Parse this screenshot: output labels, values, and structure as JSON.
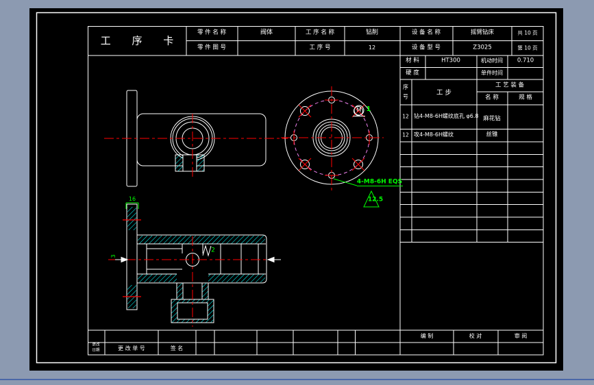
{
  "title_block": {
    "card_title": "工 序 卡",
    "part_name_label": "零 件 名 称",
    "part_name": "阀体",
    "part_no_label": "零 件 图 号",
    "part_no": "",
    "process_name_label": "工 序 名 称",
    "process_name": "钻削",
    "process_no_label": "工  序  号",
    "process_no": "12",
    "equip_name_label": "设 备 名 称",
    "equip_name": "摇臂钻床",
    "equip_model_label": "设 备 型 号",
    "equip_model": "Z3025",
    "pages_total": "共 10 页",
    "pages_current": "第 10 页"
  },
  "info_table": {
    "material_label": "材  料",
    "material": "HT300",
    "hardness_label": "硬  度",
    "hardness": "",
    "machine_time_label": "机动时间",
    "machine_time": "0.710",
    "piece_time_label": "单件时间",
    "piece_time": "",
    "seq_label": "序\n号",
    "step_label": "工      步",
    "tooling_label": "工 艺 装 备",
    "tool_name_label": "名  称",
    "tool_spec_label": "规  格",
    "steps": [
      {
        "no": "12",
        "desc": "钻4-M8-6H螺纹底孔 φ6.8",
        "tool": "麻花钻",
        "spec": ""
      },
      {
        "no": "12",
        "desc": "攻4-M8-6H螺纹",
        "tool": "丝锥",
        "spec": ""
      }
    ]
  },
  "footer": {
    "change_header": "更改\n日期",
    "change_no_label": "更 改 单 号",
    "sign_label": "签  名",
    "compile_label": "编  制",
    "check_label": "校  对",
    "review_label": "审  阅"
  },
  "annotations": {
    "thread_callout": "4-M8-6H EQS",
    "roughness": "12.5",
    "datum_m": "M",
    "datum_index": "1",
    "dim_flange_width": "16",
    "dim_left": "3",
    "dim_groove": "2"
  },
  "colors": {
    "background": "#8C9AB1",
    "sheet": "#000000",
    "line": "#FFFFFF",
    "centerline": "#FF0000",
    "hatch": "#00FFFF",
    "dimension": "#00FF00",
    "bolt_circle": "#EE82EE",
    "window_line": "#4A67A8"
  }
}
